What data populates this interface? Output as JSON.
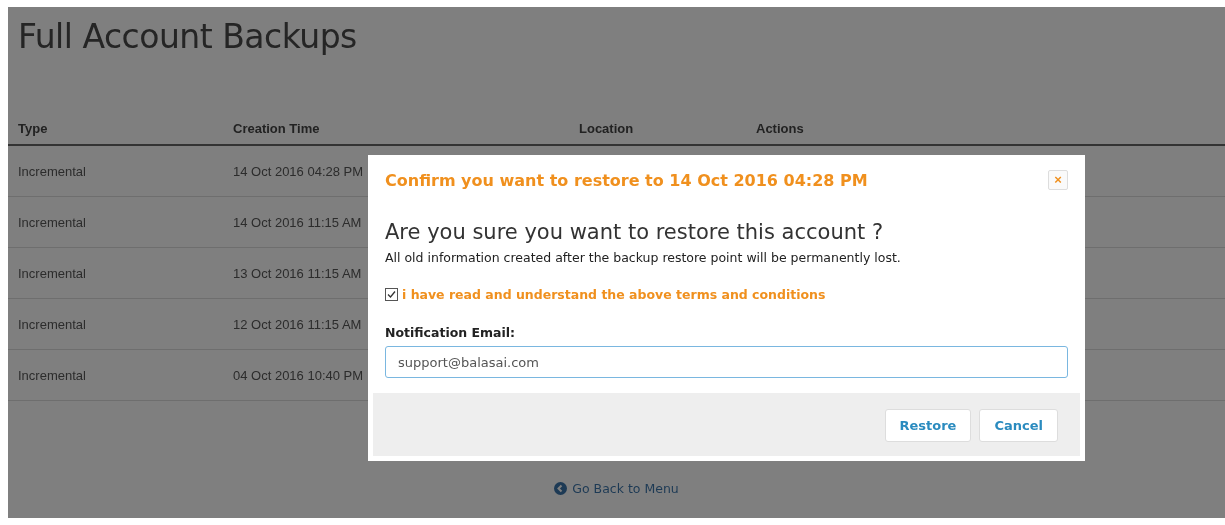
{
  "page": {
    "title": "Full Account Backups"
  },
  "table": {
    "columns": [
      "Type",
      "Creation Time",
      "Location",
      "Actions"
    ],
    "rows": [
      {
        "type": "Incremental",
        "creation_time": "14 Oct 2016 04:28 PM"
      },
      {
        "type": "Incremental",
        "creation_time": "14 Oct 2016 11:15 AM"
      },
      {
        "type": "Incremental",
        "creation_time": "13 Oct 2016 11:15 AM"
      },
      {
        "type": "Incremental",
        "creation_time": "12 Oct 2016 11:15 AM"
      },
      {
        "type": "Incremental",
        "creation_time": "04 Oct 2016 10:40 PM"
      }
    ]
  },
  "back_link": "Go Back to Menu",
  "dialog": {
    "title": "Confirm you want to restore to 14 Oct 2016 04:28 PM",
    "close": "×",
    "heading": "Are you sure you want to restore this account ?",
    "message": "All old information created after the backup restore point will be permanently lost.",
    "agree": {
      "label": "i have read and understand the above terms and conditions",
      "checked": true
    },
    "email": {
      "label": "Notification Email:",
      "value": "support@balasai.com"
    },
    "buttons": [
      "Restore",
      "Cancel"
    ]
  }
}
